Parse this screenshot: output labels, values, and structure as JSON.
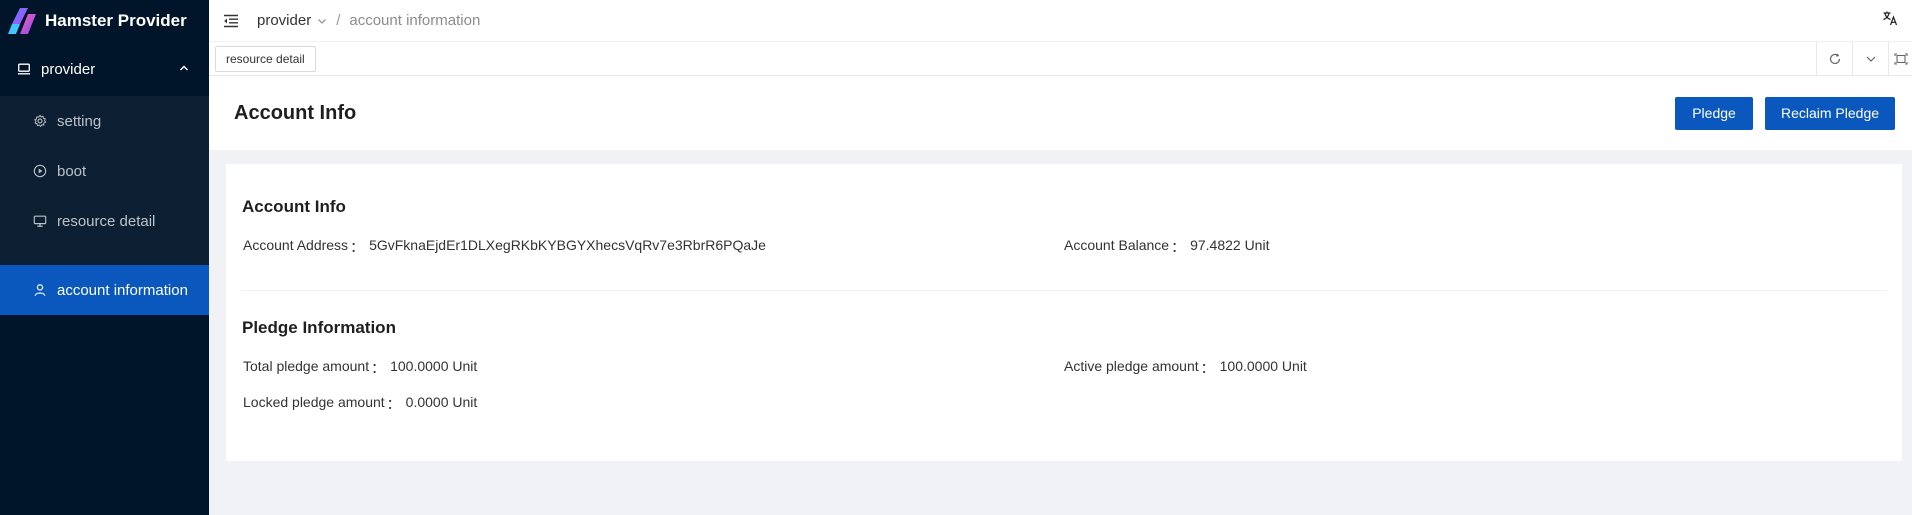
{
  "app": {
    "title": "Hamster Provider"
  },
  "sidebar": {
    "group": {
      "label": "provider",
      "icon": "desktop-icon",
      "expanded": true
    },
    "items": [
      {
        "label": "setting",
        "icon": "gear-icon",
        "active": false
      },
      {
        "label": "boot",
        "icon": "play-circle-icon",
        "active": false
      },
      {
        "label": "resource detail",
        "icon": "monitor-icon",
        "active": false
      },
      {
        "label": "account information",
        "icon": "user-icon",
        "active": true
      }
    ]
  },
  "header": {
    "breadcrumb": [
      "provider",
      "account information"
    ],
    "separator": "/"
  },
  "tabs": [
    {
      "label": "resource detail"
    }
  ],
  "page": {
    "title": "Account Info",
    "buttons": {
      "pledge": "Pledge",
      "reclaim": "Reclaim Pledge"
    }
  },
  "account": {
    "title": "Account Info",
    "address_label": "Account Address",
    "address_value": "5GvFknaEjdEr1DLXegRKbKYBGYXhecsVqRv7e3RbrR6PQaJe",
    "balance_label": "Account Balance",
    "balance_value": "97.4822 Unit"
  },
  "pledge": {
    "title": "Pledge Information",
    "total_label": "Total pledge amount",
    "total_value": "100.0000 Unit",
    "active_label": "Active pledge amount",
    "active_value": "100.0000 Unit",
    "locked_label": "Locked pledge amount",
    "locked_value": "0.0000 Unit"
  },
  "colon": "："
}
